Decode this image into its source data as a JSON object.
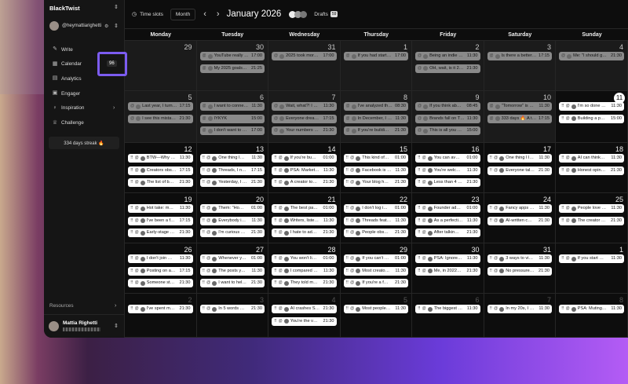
{
  "workspace": "BlackTwist",
  "account": "@heymattiarighetti",
  "nav": [
    {
      "icon": "pencil-icon",
      "label": "Write"
    },
    {
      "icon": "calendar-icon",
      "label": "Calendar",
      "badge": "96"
    },
    {
      "icon": "chart-icon",
      "label": "Analytics"
    },
    {
      "icon": "engager-icon",
      "label": "Engager"
    },
    {
      "icon": "bulb-icon",
      "label": "Inspiration"
    },
    {
      "icon": "trophy-icon",
      "label": "Challenge"
    }
  ],
  "streak": "334 days streak 🔥",
  "resources": "Resources",
  "user": {
    "name": "Mattia Righetti"
  },
  "toolbar": {
    "time_slots": "Time slots",
    "view": "Month",
    "month": "January 2026",
    "drafts": "Drafts",
    "drafts_count": "59"
  },
  "days": [
    "Monday",
    "Tuesday",
    "Wednesday",
    "Thursday",
    "Friday",
    "Saturday",
    "Sunday"
  ],
  "weeks": [
    [
      {
        "n": "29",
        "s": "out",
        "p": []
      },
      {
        "n": "30",
        "s": "out",
        "p": [
          [
            "YouTube really …",
            "17:00"
          ],
          [
            "My 2025 goals…",
            "21:25"
          ]
        ]
      },
      {
        "n": "31",
        "s": "out",
        "p": [
          [
            "2025 took mor…",
            "17:00"
          ]
        ]
      },
      {
        "n": "1",
        "s": "past",
        "p": [
          [
            "If you had start…",
            "17:00"
          ]
        ]
      },
      {
        "n": "2",
        "s": "past",
        "p": [
          [
            "Being an indie …",
            "11:30"
          ],
          [
            "OH, wait, is it 2…",
            "21:30"
          ]
        ]
      },
      {
        "n": "3",
        "s": "past",
        "p": [
          [
            "Is there a better…",
            "17:15"
          ]
        ]
      },
      {
        "n": "4",
        "s": "past",
        "p": [
          [
            "Me: \"I should g…",
            "21:30"
          ]
        ]
      }
    ],
    [
      {
        "n": "5",
        "s": "past",
        "p": [
          [
            "Last year, I turn…",
            "17:15"
          ],
          [
            "I see this mista…",
            "21:30"
          ]
        ]
      },
      {
        "n": "6",
        "s": "past",
        "p": [
          [
            "I want to conne…",
            "11:30"
          ],
          [
            "IYKYK",
            "15:00"
          ],
          [
            "I don't want to …",
            "17:00"
          ]
        ]
      },
      {
        "n": "7",
        "s": "past",
        "p": [
          [
            "Wait, what?! I …",
            "11:30"
          ],
          [
            "Everyone drea…",
            "17:15"
          ],
          [
            "Your numbers …",
            "21:30"
          ]
        ]
      },
      {
        "n": "8",
        "s": "past",
        "p": [
          [
            "I've analyzed th…",
            "08:30"
          ],
          [
            "In December, I …",
            "11:30"
          ],
          [
            "If you're buildi…",
            "21:30"
          ]
        ]
      },
      {
        "n": "9",
        "s": "past",
        "p": [
          [
            "If you think ab…",
            "08:45"
          ],
          [
            "Brands fall on T…",
            "11:30"
          ],
          [
            "This is all you …",
            "15:00"
          ]
        ]
      },
      {
        "n": "10",
        "s": "past",
        "p": [
          [
            "\"Tomorrow\" is …",
            "11:30"
          ],
          [
            "333 days 🔥 A t…",
            "17:15"
          ]
        ]
      },
      {
        "n": "11",
        "s": "today",
        "p": [
          [
            "I'm so done …",
            "11:30"
          ],
          [
            "Building a p…",
            "15:00"
          ]
        ]
      }
    ],
    [
      {
        "n": "12",
        "s": "",
        "p": [
          [
            "BTW—Why …",
            "11:30"
          ],
          [
            "Creators obs…",
            "17:15"
          ],
          [
            "The list of b…",
            "21:30"
          ]
        ]
      },
      {
        "n": "13",
        "s": "",
        "p": [
          [
            "One thing I…",
            "11:30"
          ],
          [
            "Threads, I n…",
            "17:15"
          ],
          [
            "Yesterday, I …",
            "21:30"
          ]
        ]
      },
      {
        "n": "14",
        "s": "",
        "p": [
          [
            "If you're bu…",
            "01:00"
          ],
          [
            "PSA: Market…",
            "11:30"
          ],
          [
            "A creator to…",
            "21:30"
          ]
        ]
      },
      {
        "n": "15",
        "s": "",
        "p": [
          [
            "This kind of…",
            "01:00"
          ],
          [
            "Facebook is …",
            "11:30"
          ],
          [
            "Your blog h…",
            "21:30"
          ]
        ]
      },
      {
        "n": "16",
        "s": "",
        "p": [
          [
            "You can av…",
            "01:00"
          ],
          [
            "You're welc…",
            "11:30"
          ],
          [
            "Less than 4 …",
            "21:30"
          ]
        ]
      },
      {
        "n": "17",
        "s": "",
        "p": [
          [
            "One thing I l…",
            "11:30"
          ],
          [
            "Everyone tal…",
            "21:30"
          ]
        ]
      },
      {
        "n": "18",
        "s": "",
        "p": [
          [
            "AI can think…",
            "11:30"
          ],
          [
            "Honest opin…",
            "21:30"
          ]
        ]
      }
    ],
    [
      {
        "n": "19",
        "s": "",
        "p": [
          [
            "Hot take: m…",
            "11:30"
          ],
          [
            "I've been a f…",
            "17:15"
          ],
          [
            "Early-stage …",
            "21:30"
          ]
        ]
      },
      {
        "n": "20",
        "s": "",
        "p": [
          [
            "Them: \"Ho…",
            "01:00"
          ],
          [
            "Everybody i…",
            "11:30"
          ],
          [
            "I'm curious …",
            "21:30"
          ]
        ]
      },
      {
        "n": "21",
        "s": "",
        "p": [
          [
            "The best pa…",
            "01:00"
          ],
          [
            "Writers, liste…",
            "11:30"
          ],
          [
            "I hate to ad…",
            "21:30"
          ]
        ]
      },
      {
        "n": "22",
        "s": "",
        "p": [
          [
            "I don't log i…",
            "01:00"
          ],
          [
            "Threads feat…",
            "11:30"
          ],
          [
            "People obs…",
            "21:30"
          ]
        ]
      },
      {
        "n": "23",
        "s": "",
        "p": [
          [
            "Founder ad…",
            "01:00"
          ],
          [
            "As a perfecti…",
            "11:30"
          ],
          [
            "After talkin…",
            "21:30"
          ]
        ]
      },
      {
        "n": "24",
        "s": "",
        "p": [
          [
            "Fancy apps …",
            "11:30"
          ],
          [
            "AI-written c…",
            "21:30"
          ]
        ]
      },
      {
        "n": "25",
        "s": "",
        "p": [
          [
            "People love …",
            "11:30"
          ],
          [
            "The creator …",
            "21:30"
          ]
        ]
      }
    ],
    [
      {
        "n": "26",
        "s": "",
        "p": [
          [
            "I don't join …",
            "11:30"
          ],
          [
            "Posting on a…",
            "17:15"
          ],
          [
            "Someone st…",
            "21:30"
          ]
        ]
      },
      {
        "n": "27",
        "s": "",
        "p": [
          [
            "Whenever y…",
            "01:00"
          ],
          [
            "The posts y…",
            "11:30"
          ],
          [
            "I want to hel…",
            "21:30"
          ]
        ]
      },
      {
        "n": "28",
        "s": "",
        "p": [
          [
            "You won't li…",
            "01:00"
          ],
          [
            "I compared …",
            "11:30"
          ],
          [
            "They told m…",
            "21:30"
          ]
        ]
      },
      {
        "n": "29",
        "s": "",
        "p": [
          [
            "If you can't …",
            "01:00"
          ],
          [
            "Most creato…",
            "11:30"
          ],
          [
            "If you're a f…",
            "21:30"
          ]
        ]
      },
      {
        "n": "30",
        "s": "",
        "p": [
          [
            "PSA: Ignore…",
            "11:30"
          ],
          [
            "Me, in 2022…",
            "21:30"
          ]
        ]
      },
      {
        "n": "31",
        "s": "",
        "p": [
          [
            "3 ways to vi…",
            "11:30"
          ],
          [
            "No pressure…",
            "21:30"
          ]
        ]
      },
      {
        "n": "1",
        "s": "outwhite",
        "p": [
          [
            "If you start …",
            "11:30"
          ]
        ]
      }
    ],
    [
      {
        "n": "2",
        "s": "outdark",
        "p": [
          [
            "I've spent m…",
            "21:30"
          ]
        ]
      },
      {
        "n": "3",
        "s": "outdark",
        "p": [
          [
            "In 5 words …",
            "21:30"
          ]
        ]
      },
      {
        "n": "4",
        "s": "outdark",
        "p": [
          [
            "AI crashes S…",
            "21:30"
          ],
          [
            "You're the v…",
            "21:30"
          ]
        ]
      },
      {
        "n": "5",
        "s": "outdark",
        "p": [
          [
            "Most people…",
            "11:30"
          ]
        ]
      },
      {
        "n": "6",
        "s": "outdark",
        "p": [
          [
            "The biggest …",
            "11:30"
          ]
        ]
      },
      {
        "n": "7",
        "s": "outdark",
        "p": [
          [
            "In my 20s, I …",
            "11:30"
          ]
        ]
      },
      {
        "n": "8",
        "s": "outdark",
        "p": [
          [
            "PSA: Muting…",
            "11:30"
          ]
        ]
      }
    ]
  ],
  "colors": {
    "highlight": "#7c5cf0",
    "sidebar": "#151515",
    "calendar": "#0d0d0d"
  }
}
